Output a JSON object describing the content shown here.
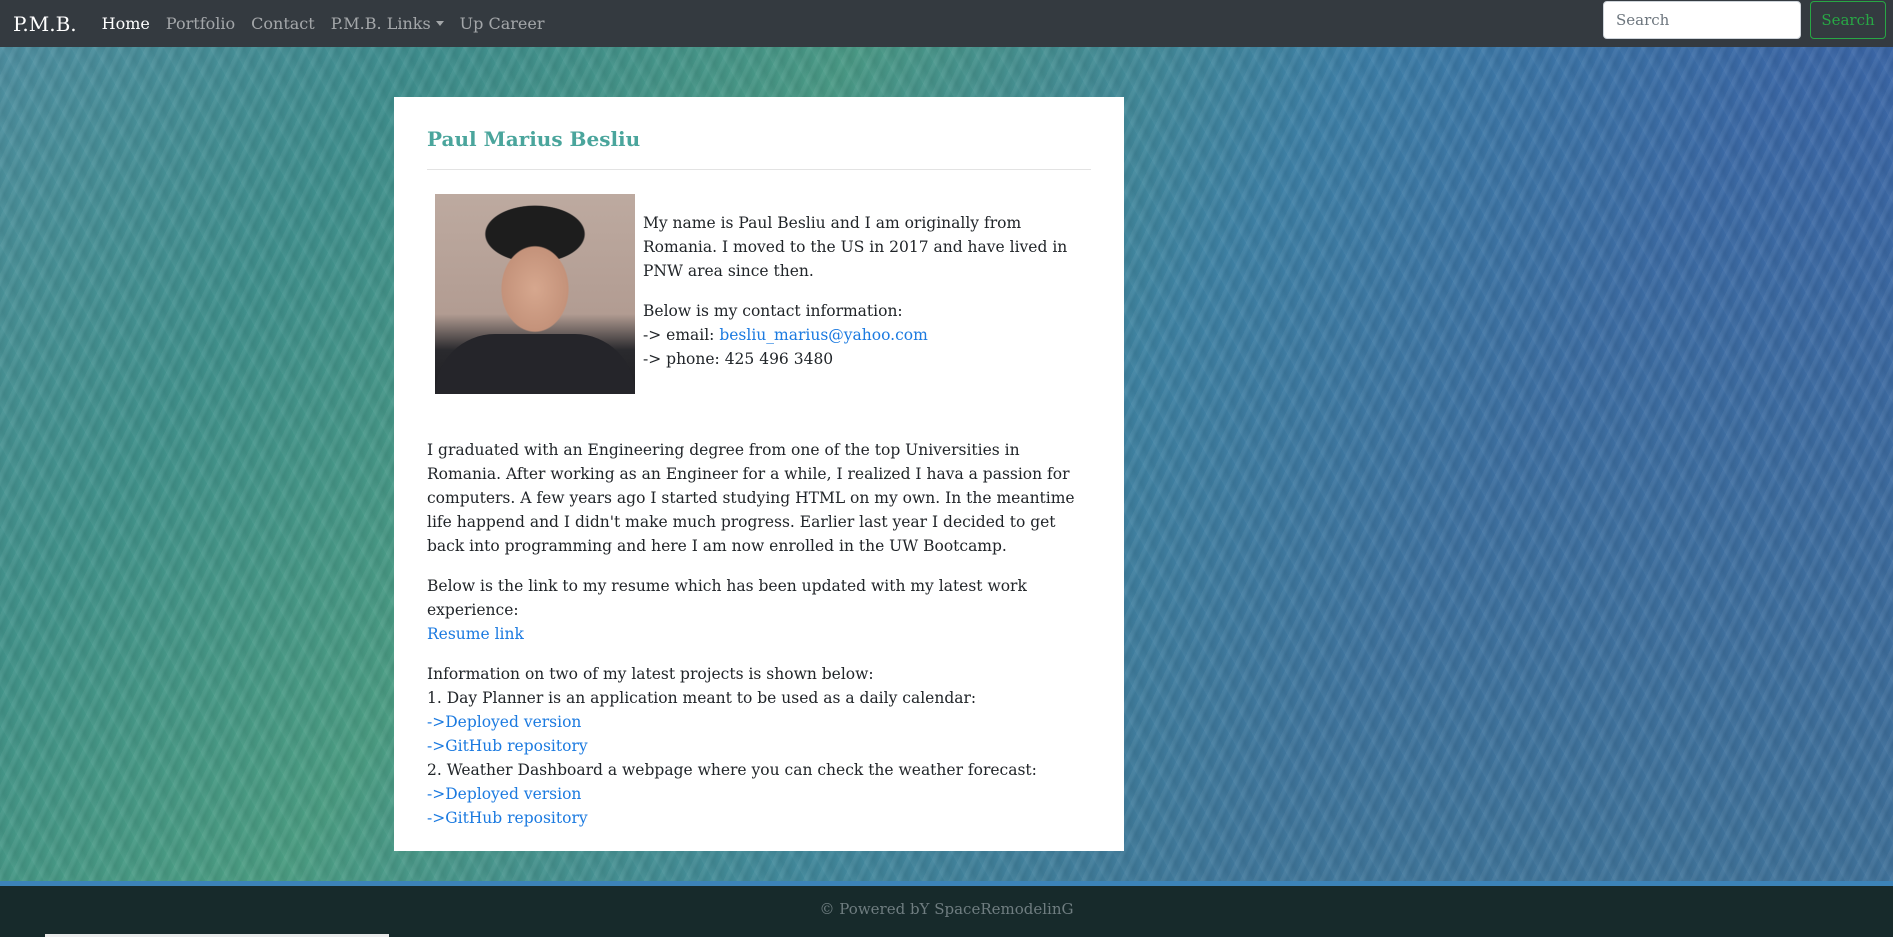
{
  "nav": {
    "brand": "P.M.B.",
    "links": [
      "Home",
      "Portfolio",
      "Contact",
      "P.M.B. Links",
      "Up Career"
    ],
    "search_placeholder": "Search",
    "search_button": "Search"
  },
  "profile": {
    "name": "Paul Marius Besliu",
    "intro": "My name is Paul Besliu and I am originally from Romania. I moved to the US in 2017 and have lived in PNW area since then.",
    "contact_heading": "Below is my contact information:",
    "email_prefix": "-> email: ",
    "email": "besliu_marius@yahoo.com",
    "phone": "-> phone: 425 496 3480"
  },
  "bio": "I graduated with an Engineering degree from one of the top Universities in Romania. After working as an Engineer for a while, I realized I hava a passion for computers. A few years ago I started studying HTML on my own. In the meantime life happend and I didn't make much progress. Earlier last year I decided to get back into programming and here I am now enrolled in the UW Bootcamp.",
  "resume": {
    "text": "Below is the link to my resume which has been updated with my latest work experience:",
    "link": "Resume link"
  },
  "projects": {
    "heading": "Information on two of my latest projects is shown below:",
    "items": [
      {
        "title": "1. Day Planner is an application meant to be used as a daily calendar:",
        "deployed": "->Deployed version",
        "repo": "->GitHub repository"
      },
      {
        "title": "2. Weather Dashboard a webpage where you can check the weather forecast:",
        "deployed": "->Deployed version",
        "repo": "->GitHub repository"
      }
    ]
  },
  "footer": "© Powered bY SpaceRemodelinG"
}
